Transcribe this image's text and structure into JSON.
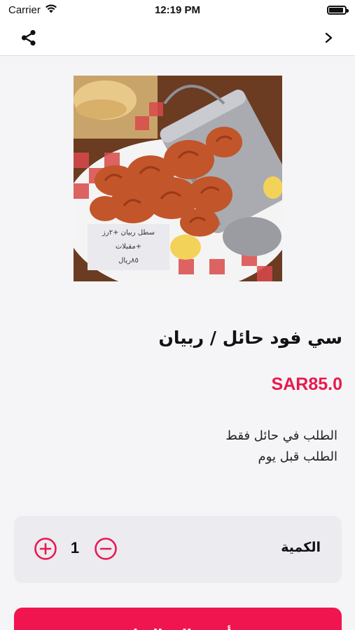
{
  "status_bar": {
    "carrier": "Carrier",
    "time": "12:19 PM",
    "battery_level": 0.9
  },
  "nav": {
    "share_icon": "share-icon",
    "forward_icon": "chevron-right-icon"
  },
  "product": {
    "image_label_lines": [
      "سطل ربيان +٢رز",
      "+مقبلات",
      "٨٥ريال"
    ],
    "title": "سي فود حائل / ربيان",
    "price": "SAR85.0",
    "description_lines": [
      "الطلب في حائل فقط",
      "الطلب قبل يوم"
    ]
  },
  "quantity": {
    "label": "الكمية",
    "value": "1",
    "plus_icon": "plus-circle-icon",
    "minus_icon": "minus-circle-icon"
  },
  "actions": {
    "add_to_cart_label": "أضف إلى السلة"
  },
  "colors": {
    "accent": "#e8194f",
    "button": "#f0154f"
  }
}
